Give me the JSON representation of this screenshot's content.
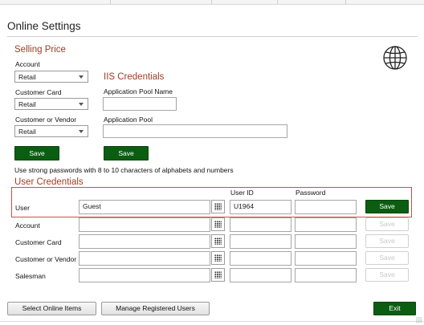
{
  "window": {
    "title": "Online Settings"
  },
  "selling_price": {
    "heading": "Selling Price",
    "account_label": "Account",
    "account_value": "Retail",
    "customer_card_label": "Customer Card",
    "customer_card_value": "Retail",
    "customer_vendor_label": "Customer or Vendor",
    "customer_vendor_value": "Retail",
    "save_label": "Save"
  },
  "iis": {
    "heading": "IIS Credentials",
    "pool_name_label": "Application Pool Name",
    "pool_name_value": "",
    "pool_label": "Application Pool",
    "pool_value": "",
    "save_label": "Save"
  },
  "password_hint": "Use strong passwords with 8 to 10 characters of alphabets and numbers",
  "user_credentials": {
    "heading": "User Credentials",
    "col_user_id": "User ID",
    "col_password": "Password",
    "rows": [
      {
        "label": "User",
        "name": "Guest",
        "user_id": "U1964",
        "password": "",
        "save_label": "Save",
        "enabled": true
      },
      {
        "label": "Account",
        "name": "",
        "user_id": "",
        "password": "",
        "save_label": "Save",
        "enabled": false
      },
      {
        "label": "Customer Card",
        "name": "",
        "user_id": "",
        "password": "",
        "save_label": "Save",
        "enabled": false
      },
      {
        "label": "Customer or Vendor",
        "name": "",
        "user_id": "",
        "password": "",
        "save_label": "Save",
        "enabled": false
      },
      {
        "label": "Salesman",
        "name": "",
        "user_id": "",
        "password": "",
        "save_label": "Save",
        "enabled": false
      }
    ]
  },
  "footer": {
    "select_items_label": "Select Online Items",
    "manage_users_label": "Manage Registered Users",
    "exit_label": "Exit"
  },
  "icons": {
    "globe": "globe-icon",
    "lookup": "grid-lookup-icon",
    "dropdown": "chevron-down-icon"
  },
  "colors": {
    "section_heading": "#9b3d24",
    "primary_button": "#0b5d12",
    "highlight_border": "#d44a4a"
  }
}
